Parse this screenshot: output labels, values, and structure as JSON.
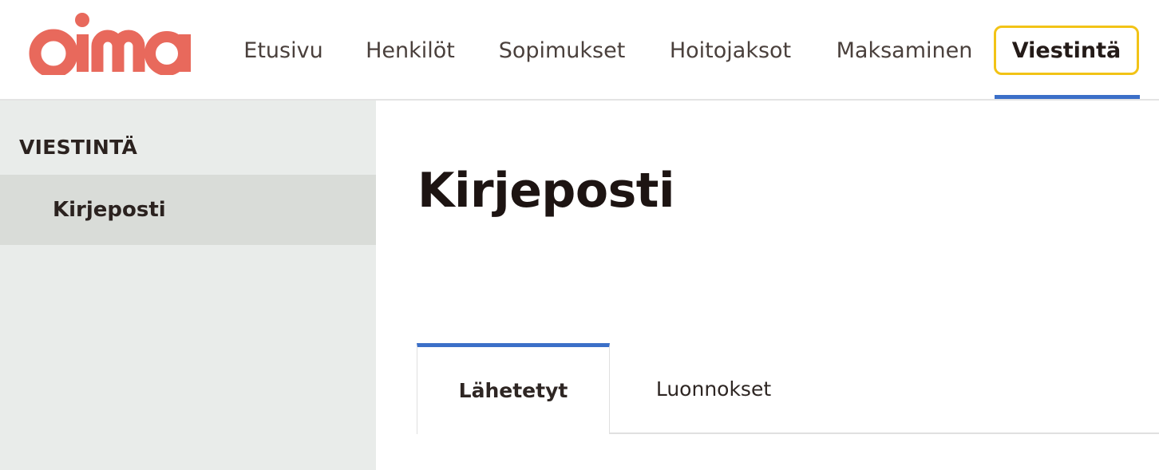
{
  "brand": {
    "logo_text": "oima",
    "logo_color": "#e8695c"
  },
  "nav": {
    "items": [
      {
        "label": "Etusivu",
        "active": false
      },
      {
        "label": "Henkilöt",
        "active": false
      },
      {
        "label": "Sopimukset",
        "active": false
      },
      {
        "label": "Hoitojaksot",
        "active": false
      },
      {
        "label": "Maksaminen",
        "active": false
      },
      {
        "label": "Viestintä",
        "active": true
      }
    ],
    "active_outline_color": "#f2c316",
    "active_underline_color": "#3b6fc8"
  },
  "sidebar": {
    "heading": "VIESTINTÄ",
    "items": [
      {
        "label": "Kirjeposti",
        "selected": true
      }
    ]
  },
  "main": {
    "title": "Kirjeposti",
    "tabs": [
      {
        "label": "Lähetetyt",
        "active": true
      },
      {
        "label": "Luonnokset",
        "active": false
      }
    ]
  }
}
